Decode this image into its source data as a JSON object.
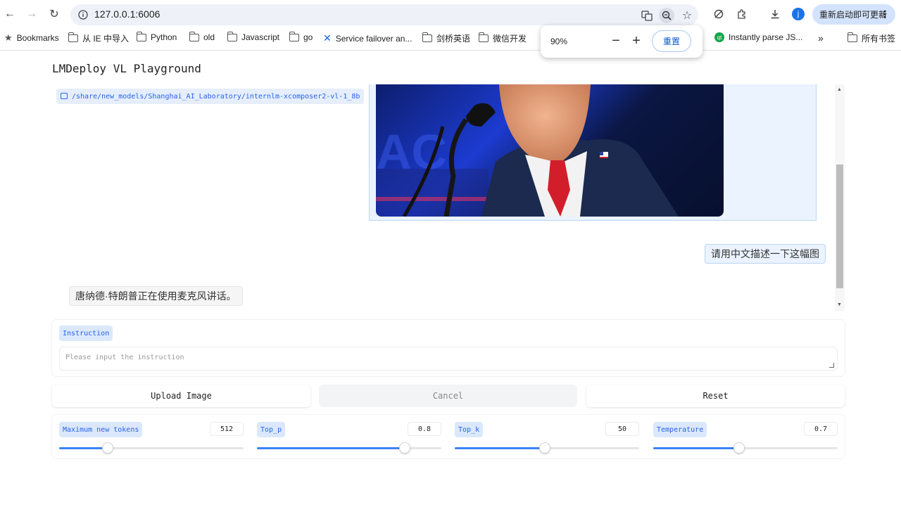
{
  "browser": {
    "url": "127.0.0.1:6006",
    "update_label": "重新启动即可更新",
    "avatar_initial": "j",
    "bookmarks": [
      {
        "label": "Bookmarks",
        "icon": "star-icon"
      },
      {
        "label": "从 IE 中导入",
        "icon": "folder-icon"
      },
      {
        "label": "Python",
        "icon": "folder-icon"
      },
      {
        "label": "old",
        "icon": "folder-icon"
      },
      {
        "label": "Javascript",
        "icon": "folder-icon"
      },
      {
        "label": "go",
        "icon": "folder-icon"
      },
      {
        "label": "Service failover an...",
        "icon": "confluence-icon"
      },
      {
        "label": "剑桥英语",
        "icon": "folder-icon"
      },
      {
        "label": "微信开发",
        "icon": "folder-icon"
      },
      {
        "label": "Instantly parse JS...",
        "icon": "qt-icon"
      },
      {
        "label": "所有书签",
        "icon": "folder-icon"
      }
    ],
    "zoom": {
      "level": "90%",
      "minus": "−",
      "plus": "+",
      "reset_label": "重置"
    }
  },
  "app": {
    "title": "LMDeploy VL Playground",
    "model_path": "/share/new_models/Shanghai_AI_Laboratory/internlm-xcomposer2-vl-1_8b",
    "chat": {
      "user_message": "请用中文描述一下这幅图",
      "bot_message": "唐纳德·特朗普正在使用麦克风讲话。"
    },
    "instruction": {
      "label": "Instruction",
      "placeholder": "Please input the instruction"
    },
    "buttons": {
      "upload": "Upload Image",
      "cancel": "Cancel",
      "reset": "Reset"
    },
    "params": [
      {
        "label": "Maximum new tokens",
        "value": "512",
        "fraction": 0.265
      },
      {
        "label": "Top_p",
        "value": "0.8",
        "fraction": 0.8
      },
      {
        "label": "Top_k",
        "value": "50",
        "fraction": 0.49
      },
      {
        "label": "Temperature",
        "value": "0.7",
        "fraction": 0.465
      }
    ]
  },
  "colors": {
    "accent": "#3b82f6",
    "label_bg": "#dbe8fb",
    "label_text": "#2563eb"
  }
}
